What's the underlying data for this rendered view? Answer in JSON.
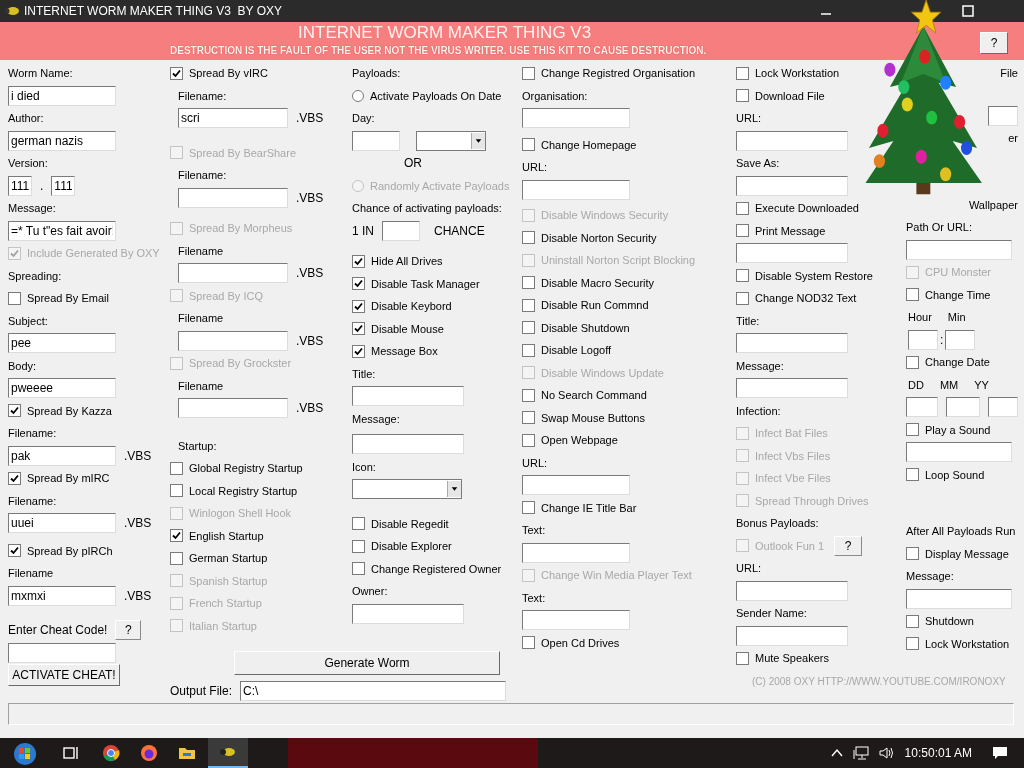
{
  "window": {
    "title": "INTERNET WORM MAKER THING V3  BY OXY"
  },
  "banner": {
    "title": "INTERNET WORM MAKER THING V3",
    "subtitle": "DESTRUCTION IS THE FAULT OF THE USER NOT THE VIRUS WRITER. USE THIS KIT TO CAUSE DESTRUCTION.",
    "help_button": "?"
  },
  "columns": [
    {
      "items": [
        {
          "kind": "label",
          "text": "Worm Name:"
        },
        {
          "kind": "field",
          "value": "i died"
        },
        {
          "kind": "label",
          "text": "Author:"
        },
        {
          "kind": "field",
          "value": "german nazis"
        },
        {
          "kind": "label",
          "text": "Version:"
        },
        {
          "kind": "pair",
          "values": [
            "111",
            "111"
          ],
          "separator": "."
        },
        {
          "kind": "label",
          "text": "Message:"
        },
        {
          "kind": "field",
          "value": "=* Tu t\"es fait avoir!"
        },
        {
          "kind": "check",
          "label": "Include Generated By OXY",
          "checked": true,
          "disabled": true
        },
        {
          "kind": "label",
          "text": "Spreading:"
        },
        {
          "kind": "check",
          "label": "Spread By Email",
          "checked": false,
          "disabled": false
        },
        {
          "kind": "label",
          "text": "Subject:"
        },
        {
          "kind": "field",
          "value": "pee"
        },
        {
          "kind": "label",
          "text": "Body:"
        },
        {
          "kind": "field",
          "value": "pweeee"
        },
        {
          "kind": "check",
          "label": "Spread By Kazza",
          "checked": true,
          "disabled": false
        },
        {
          "kind": "label",
          "text": "Filename:"
        },
        {
          "kind": "field",
          "value": "pak",
          "suffix": ".VBS"
        },
        {
          "kind": "check",
          "label": "Spread By mIRC",
          "checked": true,
          "disabled": false
        },
        {
          "kind": "label",
          "text": "Filename:"
        },
        {
          "kind": "field",
          "value": "uuei",
          "suffix": ".VBS"
        },
        {
          "kind": "check",
          "label": "Spread By pIRCh",
          "checked": true,
          "disabled": false
        },
        {
          "kind": "label",
          "text": "Filename"
        },
        {
          "kind": "field",
          "value": "mxmxi",
          "suffix": ".VBS"
        },
        {
          "kind": "label_help",
          "text": "Enter Cheat Code!",
          "button": "?"
        },
        {
          "kind": "field"
        },
        {
          "kind": "button",
          "label": "ACTIVATE CHEAT!"
        }
      ]
    },
    {
      "items": [
        {
          "kind": "check",
          "label": "Spread By vIRC",
          "checked": true,
          "disabled": false
        },
        {
          "kind": "label",
          "text": "Filename:"
        },
        {
          "kind": "field",
          "value": "scri",
          "suffix": ".VBS"
        },
        {
          "kind": "check",
          "label": "Spread By BearShare",
          "checked": false,
          "disabled": true
        },
        {
          "kind": "label",
          "text": "Filename:"
        },
        {
          "kind": "field",
          "suffix": ".VBS"
        },
        {
          "kind": "check",
          "label": "Spread By Morpheus",
          "checked": false,
          "disabled": true
        },
        {
          "kind": "label",
          "text": "Filename"
        },
        {
          "kind": "field",
          "suffix": ".VBS"
        },
        {
          "kind": "check",
          "label": "Spread By ICQ",
          "checked": false,
          "disabled": true
        },
        {
          "kind": "label",
          "text": "Filename"
        },
        {
          "kind": "field",
          "suffix": ".VBS"
        },
        {
          "kind": "check",
          "label": "Spread By Grockster",
          "checked": false,
          "disabled": true
        },
        {
          "kind": "label",
          "text": "Filename"
        },
        {
          "kind": "field",
          "suffix": ".VBS"
        },
        {
          "kind": "label",
          "text": "Startup:"
        },
        {
          "kind": "check",
          "label": "Global Registry Startup",
          "checked": false,
          "disabled": false
        },
        {
          "kind": "check",
          "label": "Local Registry Startup",
          "checked": false,
          "disabled": false
        },
        {
          "kind": "check",
          "label": "Winlogon Shell Hook",
          "checked": false,
          "disabled": true
        },
        {
          "kind": "check",
          "label": "English Startup",
          "checked": true,
          "disabled": false
        },
        {
          "kind": "check",
          "label": "German Startup",
          "checked": false,
          "disabled": false
        },
        {
          "kind": "check",
          "label": "Spanish Startup",
          "checked": false,
          "disabled": true
        },
        {
          "kind": "check",
          "label": "French Startup",
          "checked": false,
          "disabled": true
        },
        {
          "kind": "check",
          "label": "Italian Startup",
          "checked": false,
          "disabled": true
        }
      ]
    },
    {
      "items": [
        {
          "kind": "label",
          "text": "Payloads:"
        },
        {
          "kind": "radio",
          "label": "Activate Payloads On Date",
          "selected": false,
          "disabled": false
        },
        {
          "kind": "label",
          "text": "Day:"
        },
        {
          "kind": "field_combo"
        },
        {
          "kind": "note",
          "text": "OR"
        },
        {
          "kind": "radio",
          "label": "Randomly Activate Payloads",
          "selected": false,
          "disabled": true
        },
        {
          "kind": "label",
          "text": "Chance of activating payloads:"
        },
        {
          "kind": "chance",
          "prefix": "1 IN",
          "suffix": "CHANCE"
        },
        {
          "kind": "check",
          "label": "Hide All Drives",
          "checked": true,
          "disabled": false
        },
        {
          "kind": "check",
          "label": "Disable Task Manager",
          "checked": true,
          "disabled": false
        },
        {
          "kind": "check",
          "label": "Disable Keybord",
          "checked": true,
          "disabled": false
        },
        {
          "kind": "check",
          "label": "Disable Mouse",
          "checked": true,
          "disabled": false
        },
        {
          "kind": "check",
          "label": "Message Box",
          "checked": true,
          "disabled": false
        },
        {
          "kind": "label",
          "text": "Title:"
        },
        {
          "kind": "field"
        },
        {
          "kind": "label",
          "text": "Message:"
        },
        {
          "kind": "field"
        },
        {
          "kind": "label",
          "text": "Icon:"
        },
        {
          "kind": "combo"
        },
        {
          "kind": "check",
          "label": "Disable Regedit",
          "checked": false,
          "disabled": false
        },
        {
          "kind": "check",
          "label": "Disable Explorer",
          "checked": false,
          "disabled": false
        },
        {
          "kind": "check",
          "label": "Change Registered Owner",
          "checked": false,
          "disabled": false
        },
        {
          "kind": "label",
          "text": "Owner:"
        },
        {
          "kind": "field"
        }
      ]
    },
    {
      "items": [
        {
          "kind": "check",
          "label": "Change Registred Organisation",
          "checked": false,
          "disabled": false
        },
        {
          "kind": "label",
          "text": "Organisation:"
        },
        {
          "kind": "field"
        },
        {
          "kind": "check",
          "label": "Change Homepage",
          "checked": false,
          "disabled": false
        },
        {
          "kind": "label",
          "text": "URL:"
        },
        {
          "kind": "field"
        },
        {
          "kind": "check",
          "label": "Disable Windows Security",
          "checked": false,
          "disabled": true
        },
        {
          "kind": "check",
          "label": "Disable Norton Security",
          "checked": false,
          "disabled": false
        },
        {
          "kind": "check",
          "label": "Uninstall Norton Script Blocking",
          "checked": false,
          "disabled": true
        },
        {
          "kind": "check",
          "label": "Disable Macro Security",
          "checked": false,
          "disabled": false
        },
        {
          "kind": "check",
          "label": "Disable Run Commnd",
          "checked": false,
          "disabled": false
        },
        {
          "kind": "check",
          "label": "Disable Shutdown",
          "checked": false,
          "disabled": false
        },
        {
          "kind": "check",
          "label": "Disable Logoff",
          "checked": false,
          "disabled": false
        },
        {
          "kind": "check",
          "label": "Disable Windows Update",
          "checked": false,
          "disabled": true
        },
        {
          "kind": "check",
          "label": "No Search Command",
          "checked": false,
          "disabled": false
        },
        {
          "kind": "check",
          "label": "Swap Mouse Buttons",
          "checked": false,
          "disabled": false
        },
        {
          "kind": "check",
          "label": "Open Webpage",
          "checked": false,
          "disabled": false
        },
        {
          "kind": "label",
          "text": "URL:"
        },
        {
          "kind": "field"
        },
        {
          "kind": "check",
          "label": "Change IE Title Bar",
          "checked": false,
          "disabled": false
        },
        {
          "kind": "label",
          "text": "Text:"
        },
        {
          "kind": "field"
        },
        {
          "kind": "check",
          "label": "Change Win Media Player Text",
          "checked": false,
          "disabled": true
        },
        {
          "kind": "label",
          "text": "Text:"
        },
        {
          "kind": "field"
        },
        {
          "kind": "check",
          "label": "Open Cd Drives",
          "checked": false,
          "disabled": false
        }
      ]
    },
    {
      "items": [
        {
          "kind": "check",
          "label": "Lock Workstation",
          "checked": false,
          "disabled": false
        },
        {
          "kind": "check",
          "label": "Download File",
          "checked": false,
          "disabled": false
        },
        {
          "kind": "label",
          "text": "URL:"
        },
        {
          "kind": "field"
        },
        {
          "kind": "label",
          "text": "Save As:"
        },
        {
          "kind": "field"
        },
        {
          "kind": "check",
          "label": "Execute Downloaded",
          "checked": false,
          "disabled": false
        },
        {
          "kind": "check",
          "label": "Print Message",
          "checked": false,
          "disabled": false
        },
        {
          "kind": "field"
        },
        {
          "kind": "check",
          "label": "Disable System Restore",
          "checked": false,
          "disabled": false
        },
        {
          "kind": "check",
          "label": "Change NOD32 Text",
          "checked": false,
          "disabled": false
        },
        {
          "kind": "label",
          "text": "Title:"
        },
        {
          "kind": "field"
        },
        {
          "kind": "label",
          "text": "Message:"
        },
        {
          "kind": "field"
        },
        {
          "kind": "label",
          "text": "Infection:"
        },
        {
          "kind": "check",
          "label": "Infect Bat Files",
          "checked": false,
          "disabled": true
        },
        {
          "kind": "check",
          "label": "Infect Vbs Files",
          "checked": false,
          "disabled": true
        },
        {
          "kind": "check",
          "label": "Infect Vbe Files",
          "checked": false,
          "disabled": true
        },
        {
          "kind": "check",
          "label": "Spread Through Drives",
          "checked": false,
          "disabled": true
        },
        {
          "kind": "label",
          "text": "Bonus Payloads:"
        },
        {
          "kind": "check",
          "label": "Outlook Fun 1",
          "checked": false,
          "disabled": true,
          "help": "?"
        },
        {
          "kind": "label",
          "text": "URL:"
        },
        {
          "kind": "field"
        },
        {
          "kind": "label",
          "text": "Sender Name:"
        },
        {
          "kind": "field"
        },
        {
          "kind": "check",
          "label": "Mute Speakers",
          "checked": false,
          "disabled": false
        }
      ]
    },
    {
      "items": [
        {
          "kind": "fragment",
          "text": "File"
        },
        {
          "kind": "partial_field"
        },
        {
          "kind": "fragment",
          "text": "er"
        },
        {
          "kind": "fragment",
          "text": "Wallpaper"
        },
        {
          "kind": "label",
          "text": "Path Or URL:"
        },
        {
          "kind": "field"
        },
        {
          "kind": "check",
          "label": "CPU Monster",
          "checked": false,
          "disabled": true
        },
        {
          "kind": "check",
          "label": "Change Time",
          "checked": false,
          "disabled": false
        },
        {
          "kind": "labels",
          "texts": [
            "Hour",
            "Min"
          ]
        },
        {
          "kind": "time_fields",
          "separator": ":"
        },
        {
          "kind": "check",
          "label": "Change Date",
          "checked": false,
          "disabled": false
        },
        {
          "kind": "labels",
          "texts": [
            "DD",
            "MM",
            "YY"
          ]
        },
        {
          "kind": "date_fields"
        },
        {
          "kind": "check",
          "label": "Play a Sound",
          "checked": false,
          "disabled": false
        },
        {
          "kind": "field"
        },
        {
          "kind": "check",
          "label": "Loop Sound",
          "checked": false,
          "disabled": false
        },
        {
          "kind": "label",
          "text": "After All Payloads Run"
        },
        {
          "kind": "check",
          "label": "Display Message",
          "checked": false,
          "disabled": false
        },
        {
          "kind": "label",
          "text": "Message:"
        },
        {
          "kind": "field"
        },
        {
          "kind": "check",
          "label": "Shutdown",
          "checked": false,
          "disabled": false
        },
        {
          "kind": "check",
          "label": "Lock Workstation",
          "checked": false,
          "disabled": false
        }
      ]
    }
  ],
  "actions": {
    "generate_button": "Generate Worm",
    "output_label": "Output File:",
    "output_value": "C:\\"
  },
  "copyright": "(C) 2008 OXY HTTP://WWW.YOUTUBE.COM/IRONOXY",
  "taskbar": {
    "clock": "10:50:01 AM"
  }
}
